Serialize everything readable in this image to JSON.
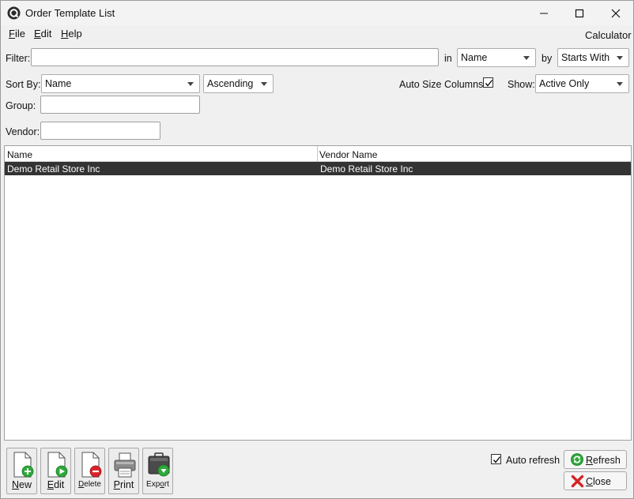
{
  "window": {
    "title": "Order Template List"
  },
  "menu": {
    "file": {
      "accel": "F",
      "rest": "ile"
    },
    "edit": {
      "accel": "E",
      "rest": "dit"
    },
    "help": {
      "accel": "H",
      "rest": "elp"
    },
    "calculator": "Calculator"
  },
  "filter": {
    "label": "Filter:",
    "value": "",
    "in_label": "in",
    "in_value": "Name",
    "by_label": "by",
    "by_value": "Starts With"
  },
  "sort": {
    "label": "Sort By:",
    "field": "Name",
    "direction": "Ascending"
  },
  "options": {
    "auto_size_label": "Auto Size Columns",
    "auto_size_checked": true,
    "show_label": "Show:",
    "show_value": "Active Only"
  },
  "group": {
    "label": "Group:",
    "value": ""
  },
  "vendor": {
    "label": "Vendor:",
    "value": ""
  },
  "grid": {
    "columns": [
      "Name",
      "Vendor Name"
    ],
    "rows": [
      {
        "name": "Demo Retail Store Inc",
        "vendor_name": "Demo Retail Store Inc"
      }
    ]
  },
  "toolbar": {
    "new": {
      "accel": "N",
      "rest": "ew"
    },
    "edit": {
      "accel": "E",
      "rest": "dit"
    },
    "delete": {
      "accel": "D",
      "rest": "elete"
    },
    "print": {
      "accel": "P",
      "rest": "rint"
    },
    "export": {
      "pre": "Exp",
      "accel": "o",
      "rest": "rt"
    }
  },
  "footer": {
    "auto_refresh_label": "Auto refresh",
    "auto_refresh_checked": true,
    "refresh": {
      "accel": "R",
      "rest": "efresh"
    },
    "close": {
      "accel": "C",
      "rest": "lose"
    }
  },
  "colors": {
    "selected_row": "#333333",
    "add_green": "#2ea83a",
    "delete_red": "#d8232a",
    "close_red": "#d42525"
  }
}
